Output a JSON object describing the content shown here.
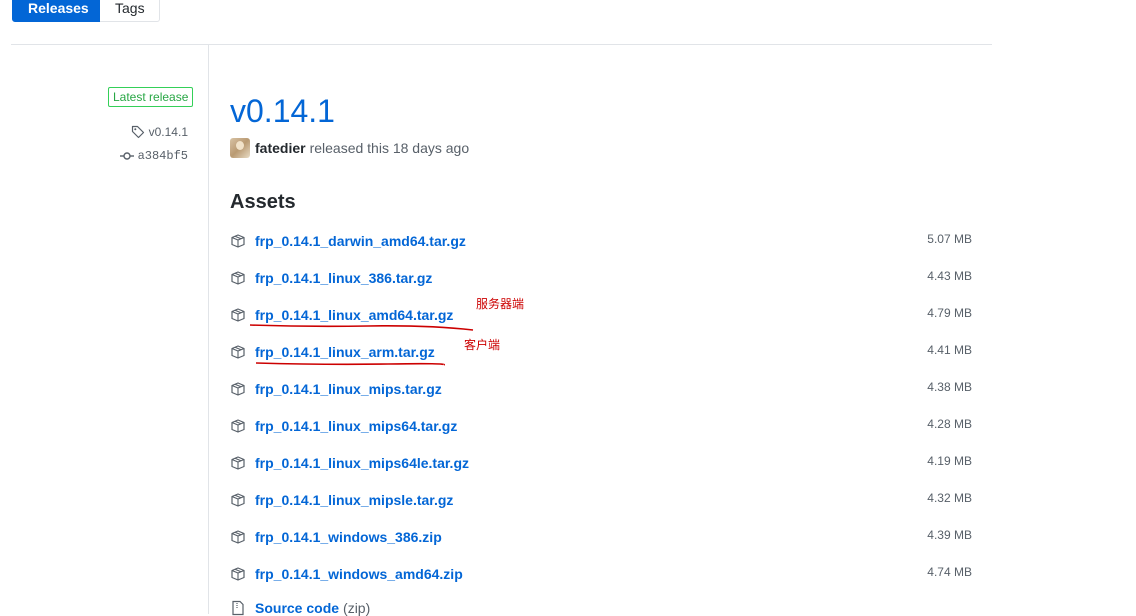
{
  "tabs": {
    "releases": "Releases",
    "tags": "Tags"
  },
  "sidebar": {
    "latest_badge": "Latest release",
    "tag": "v0.14.1",
    "commit": "a384bf5"
  },
  "release": {
    "title": "v0.14.1",
    "author": "fatedier",
    "released_text": "released this 18 days ago"
  },
  "assets": {
    "heading": "Assets",
    "items": [
      {
        "name": "frp_0.14.1_darwin_amd64.tar.gz",
        "size": "5.07 MB"
      },
      {
        "name": "frp_0.14.1_linux_386.tar.gz",
        "size": "4.43 MB"
      },
      {
        "name": "frp_0.14.1_linux_amd64.tar.gz",
        "size": "4.79 MB",
        "note": "服务器端"
      },
      {
        "name": "frp_0.14.1_linux_arm.tar.gz",
        "size": "4.41 MB",
        "note": "客户端"
      },
      {
        "name": "frp_0.14.1_linux_mips.tar.gz",
        "size": "4.38 MB"
      },
      {
        "name": "frp_0.14.1_linux_mips64.tar.gz",
        "size": "4.28 MB"
      },
      {
        "name": "frp_0.14.1_linux_mips64le.tar.gz",
        "size": "4.19 MB"
      },
      {
        "name": "frp_0.14.1_linux_mipsle.tar.gz",
        "size": "4.32 MB"
      },
      {
        "name": "frp_0.14.1_windows_386.zip",
        "size": "4.39 MB"
      },
      {
        "name": "frp_0.14.1_windows_amd64.zip",
        "size": "4.74 MB"
      }
    ],
    "source": {
      "label": "Source code",
      "format": "(zip)"
    }
  },
  "colors": {
    "link": "#0366d6",
    "badge_green": "#28a745",
    "annotation_red": "#cc0000"
  },
  "icons": [
    "tag-icon",
    "commit-icon",
    "package-icon",
    "file-zip-icon"
  ]
}
